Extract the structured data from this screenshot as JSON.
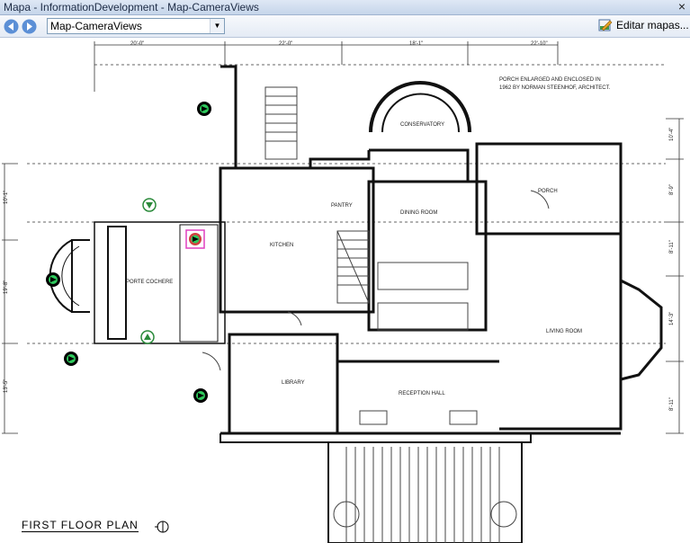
{
  "window": {
    "title": "Mapa - InformationDevelopment - Map-CameraViews",
    "close_glyph": "×"
  },
  "toolbar": {
    "map_select_value": "Map-CameraViews",
    "edit_maps_label": "Editar mapas..."
  },
  "plan": {
    "caption": "FIRST FLOOR PLAN",
    "note_lines": [
      "PORCH ENLARGED AND ENCLOSED IN",
      "1962 BY NORMAN STEENHOF, ARCHITECT."
    ],
    "dimensions_top": [
      "20'-0\"",
      "22'-0\"",
      "18'-1\"",
      "22'-10\""
    ],
    "dimensions_left": [
      "10'-1\"",
      "19'-8\"",
      "13'-5\""
    ],
    "dimensions_right": [
      "10'-4\"",
      "8'-9\"",
      "8'-11\"",
      "14'-3\"",
      "8'-11\""
    ],
    "rooms": {
      "conservatory": "CONSERVATORY",
      "porch": "PORCH",
      "pantry": "PANTRY",
      "dining": "DINING ROOM",
      "kitchen": "KITCHEN",
      "porte": "PORTE COCHERE",
      "living": "LIVING ROOM",
      "library": "LIBRARY",
      "reception": "RECEPTION HALL"
    }
  },
  "colors": {
    "camera_fill": "#2ec95c",
    "camera_ring": "#000000",
    "selected_outline": "#e040c0",
    "camera_alt_ring": "#2a8a3a"
  }
}
